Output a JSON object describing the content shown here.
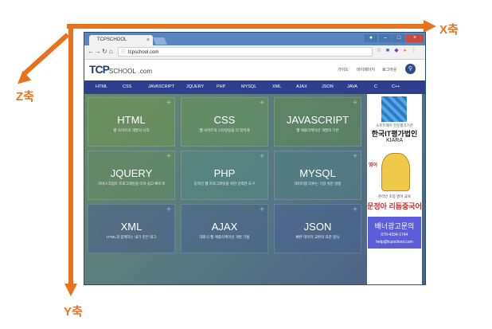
{
  "axes": {
    "x_label": "X축",
    "y_label": "Y축",
    "z_label": "Z축",
    "color": "#e8731f"
  },
  "browser": {
    "tab_title": "TCPSCHOOL",
    "tab_close": "×",
    "url": "tcpschool.com",
    "window_buttons": {
      "minimize": "–",
      "maximize": "□",
      "close": "×"
    }
  },
  "site": {
    "logo_main": "TCP",
    "logo_rest": "SCHOOL",
    "logo_suffix": ".com",
    "top_links": [
      "가이드",
      "마이페이지",
      "로그아웃"
    ],
    "menu": [
      "HTML",
      "CSS",
      "JAVASCRIPT",
      "JQUERY",
      "PHP",
      "MYSQL",
      "XML",
      "AJAX",
      "JSON",
      "JAVA",
      "C",
      "C++"
    ],
    "tiles": [
      {
        "title": "HTML",
        "desc": "웹 사이트의 개발의 시작"
      },
      {
        "title": "CSS",
        "desc": "웹 사이트의 스타일링을 더 멋지게"
      },
      {
        "title": "JAVASCRIPT",
        "desc": "웹 애플리케이션 개발의 기본"
      },
      {
        "title": "JQUERY",
        "desc": "자바스크립트 프로그래밍을 더욱 쉽고 빠르게"
      },
      {
        "title": "PHP",
        "desc": "동적인 웹 프로그래밍을 위한 강력한 도구"
      },
      {
        "title": "MYSQL",
        "desc": "데이터를 다루는 가장 쉬운 방법"
      },
      {
        "title": "XML",
        "desc": "HTML과 함께하는 내가 만든 태그"
      },
      {
        "title": "AJAX",
        "desc": "대화식 웹 애플리케이션 개발 기법"
      },
      {
        "title": "JSON",
        "desc": "빠른 데이터 교환의 표준 형식"
      }
    ],
    "tile_plus": "+"
  },
  "ads": {
    "ad1_small": "소프트웨어 전문평가기관",
    "ad1_main": "한국IT평가법인",
    "ad1_sub": "KIARA",
    "ad2_word": "영어",
    "ad2_small": "온라인 초등 영어 교육",
    "ad2_main": "문정아 리듬중국어",
    "ad3_title": "배너광고문의",
    "ad3_phone": "070-4334-1744",
    "ad3_email": "help@tcpschool.com"
  }
}
